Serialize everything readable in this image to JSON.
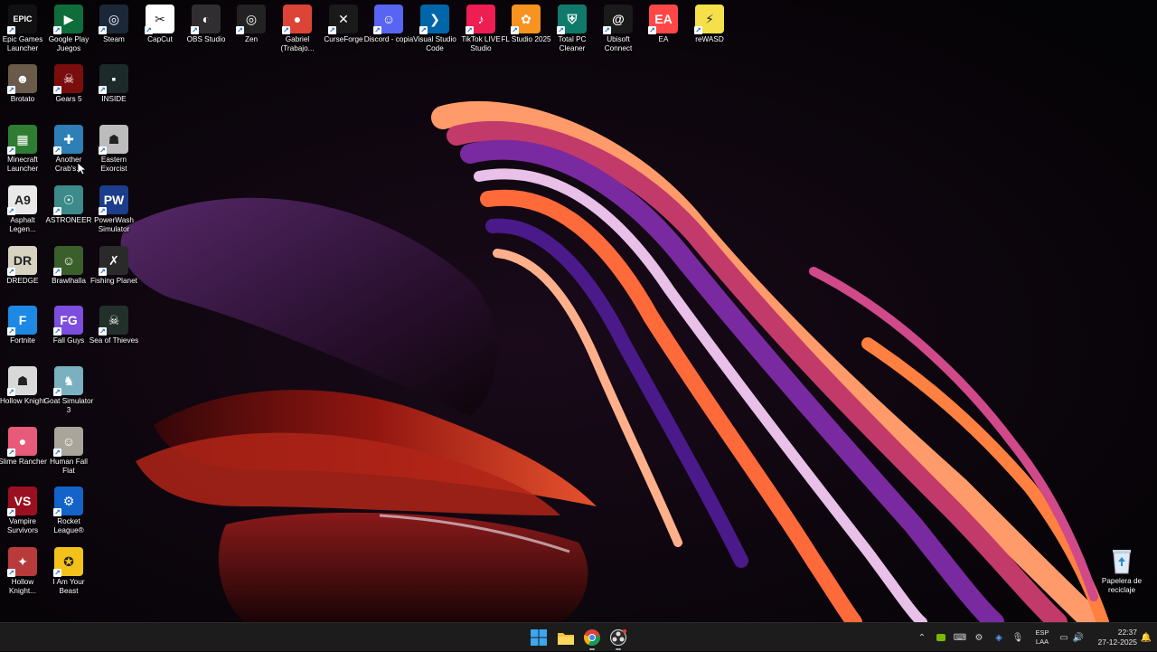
{
  "desktop": {
    "icons": [
      {
        "id": "epic",
        "label": "Epic Games Launcher",
        "icon": "epic-games-icon",
        "bg": "#111111",
        "glyph": "EPIC"
      },
      {
        "id": "gplay",
        "label": "Google Play Juegos",
        "icon": "google-play-games-icon",
        "bg": "#0f6d3a",
        "glyph": "▶"
      },
      {
        "id": "steam",
        "label": "Steam",
        "icon": "steam-icon",
        "bg": "#1b2838",
        "glyph": "◎"
      },
      {
        "id": "capcut",
        "label": "CapCut",
        "icon": "capcut-icon",
        "bg": "#ffffff",
        "glyph": "✂"
      },
      {
        "id": "obs",
        "label": "OBS Studio",
        "icon": "obs-studio-icon",
        "bg": "#302e31",
        "glyph": "◐"
      },
      {
        "id": "zen",
        "label": "Zen",
        "icon": "zen-browser-icon",
        "bg": "#222222",
        "glyph": "◎"
      },
      {
        "id": "chrome",
        "label": "Gabriel (Trabajo...",
        "icon": "chrome-icon",
        "bg": "#db4437",
        "glyph": "●"
      },
      {
        "id": "curse",
        "label": "CurseForge",
        "icon": "curseforge-icon",
        "bg": "#1a1a1a",
        "glyph": "✕"
      },
      {
        "id": "discord",
        "label": "Discord - copia",
        "icon": "discord-icon",
        "bg": "#5865f2",
        "glyph": "☺"
      },
      {
        "id": "vscode",
        "label": "Visual Studio Code",
        "icon": "vscode-icon",
        "bg": "#0065a9",
        "glyph": "❯"
      },
      {
        "id": "tiktok",
        "label": "TikTok LIVE Studio",
        "icon": "tiktok-live-icon",
        "bg": "#ee1d52",
        "glyph": "♪"
      },
      {
        "id": "fl",
        "label": "FL Studio 2025",
        "icon": "fl-studio-icon",
        "bg": "#f7931e",
        "glyph": "✿"
      },
      {
        "id": "totalpc",
        "label": "Total PC Cleaner",
        "icon": "total-pc-cleaner-icon",
        "bg": "#0f7a6c",
        "glyph": "⛨"
      },
      {
        "id": "ubisoft",
        "label": "Ubisoft Connect",
        "icon": "ubisoft-icon",
        "bg": "#1a1a1a",
        "glyph": "@"
      },
      {
        "id": "ea",
        "label": "EA",
        "icon": "ea-icon",
        "bg": "#ff4747",
        "glyph": "EA"
      },
      {
        "id": "rewasd",
        "label": "reWASD",
        "icon": "rewasd-icon",
        "bg": "#f5e04a",
        "glyph": "⚡"
      },
      {
        "id": "brotato",
        "label": "Brotato",
        "icon": "brotato-icon",
        "bg": "#6a5a4a",
        "glyph": "☻"
      },
      {
        "id": "gears",
        "label": "Gears 5",
        "icon": "gears5-icon",
        "bg": "#7a0d0d",
        "glyph": "☠"
      },
      {
        "id": "inside",
        "label": "INSIDE",
        "icon": "inside-icon",
        "bg": "#1c2a2a",
        "glyph": "▪"
      },
      {
        "id": "minecraft",
        "label": "Minecraft Launcher",
        "icon": "minecraft-icon",
        "bg": "#2e7d32",
        "glyph": "▦"
      },
      {
        "id": "crab",
        "label": "Another Crab's...",
        "icon": "crab-game-icon",
        "bg": "#2d7fb5",
        "glyph": "✚"
      },
      {
        "id": "exorcist",
        "label": "Eastern Exorcist",
        "icon": "eastern-exorcist-icon",
        "bg": "#bcbcbc",
        "glyph": "☗"
      },
      {
        "id": "asphalt",
        "label": "Asphalt Legen...",
        "icon": "asphalt-icon",
        "bg": "#e9e9e9",
        "glyph": "A9"
      },
      {
        "id": "astroneer",
        "label": "ASTRONEER",
        "icon": "astroneer-icon",
        "bg": "#3c8a8a",
        "glyph": "☉"
      },
      {
        "id": "powerwash",
        "label": "PowerWash Simulator",
        "icon": "powerwash-icon",
        "bg": "#1b3d8c",
        "glyph": "PW"
      },
      {
        "id": "dredge",
        "label": "DREDGE",
        "icon": "dredge-icon",
        "bg": "#d8d2c0",
        "glyph": "DR"
      },
      {
        "id": "brawlhalla",
        "label": "Brawlhalla",
        "icon": "brawlhalla-icon",
        "bg": "#3b5f2a",
        "glyph": "☺"
      },
      {
        "id": "fishing",
        "label": "Fishing Planet",
        "icon": "fishing-planet-icon",
        "bg": "#2a2a2a",
        "glyph": "✗"
      },
      {
        "id": "fortnite",
        "label": "Fortnite",
        "icon": "fortnite-icon",
        "bg": "#1e88e5",
        "glyph": "F"
      },
      {
        "id": "fallguys",
        "label": "Fall Guys",
        "icon": "fall-guys-icon",
        "bg": "#7c4ddf",
        "glyph": "FG"
      },
      {
        "id": "seaofthieves",
        "label": "Sea of Thieves",
        "icon": "sea-of-thieves-icon",
        "bg": "#22302a",
        "glyph": "☠"
      },
      {
        "id": "hollow",
        "label": "Hollow Knight",
        "icon": "hollow-knight-icon",
        "bg": "#d9d9d9",
        "glyph": "☗"
      },
      {
        "id": "goat",
        "label": "Goat Simulator 3",
        "icon": "goat-simulator-icon",
        "bg": "#7ab0c0",
        "glyph": "♞"
      },
      {
        "id": "slime",
        "label": "Slime Rancher",
        "icon": "slime-rancher-icon",
        "bg": "#e85a7a",
        "glyph": "●"
      },
      {
        "id": "humanfall",
        "label": "Human Fall Flat",
        "icon": "human-fall-flat-icon",
        "bg": "#a9a59a",
        "glyph": "☺"
      },
      {
        "id": "vampire",
        "label": "Vampire Survivors",
        "icon": "vampire-survivors-icon",
        "bg": "#9a1020",
        "glyph": "VS"
      },
      {
        "id": "rocket",
        "label": "Rocket League®",
        "icon": "rocket-league-icon",
        "bg": "#1463c9",
        "glyph": "⚙"
      },
      {
        "id": "hollow2",
        "label": "Hollow Knight...",
        "icon": "hollow-knight-silksong-icon",
        "bg": "#b83a3a",
        "glyph": "✦"
      },
      {
        "id": "beast",
        "label": "I Am Your Beast",
        "icon": "i-am-your-beast-icon",
        "bg": "#f2c21a",
        "glyph": "✪"
      }
    ],
    "recycle_bin": {
      "label": "Papelera de reciclaje",
      "icon": "recycle-bin-icon"
    }
  },
  "taskbar": {
    "apps": [
      {
        "id": "start",
        "icon": "windows-start-icon"
      },
      {
        "id": "explorer",
        "icon": "file-explorer-icon"
      },
      {
        "id": "chrome",
        "icon": "chrome-icon"
      },
      {
        "id": "obs",
        "icon": "obs-studio-icon"
      }
    ],
    "tray": {
      "icons": [
        "chevron-up-icon",
        "nvidia-icon",
        "keyboard-icon",
        "settings-icon",
        "network-icon",
        "microphone-icon",
        "speaker-icon"
      ],
      "lang_line1": "ESP",
      "lang_line2": "LAA",
      "time": "22:37",
      "date": "27-12-2025"
    }
  }
}
